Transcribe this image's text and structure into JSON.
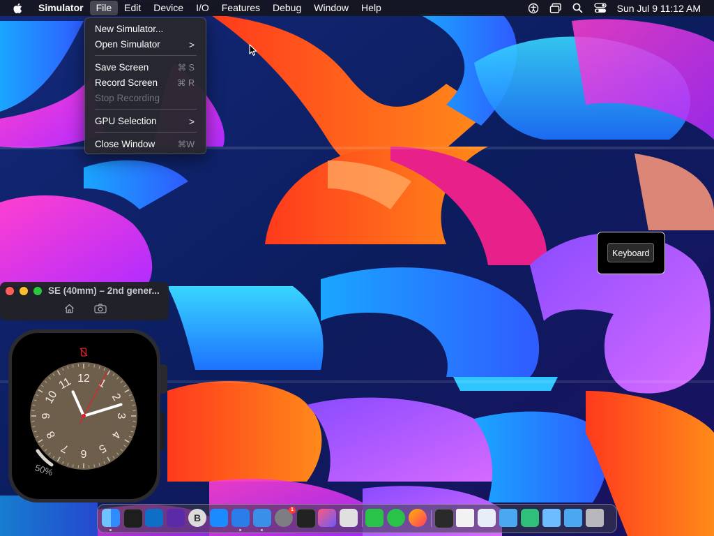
{
  "menubar": {
    "app_name": "Simulator",
    "menus": [
      "File",
      "Edit",
      "Device",
      "I/O",
      "Features",
      "Debug",
      "Window",
      "Help"
    ],
    "open_menu": "File",
    "clock": "Sun Jul 9  11:12 AM",
    "status_icons": [
      "accessibility-icon",
      "screen-mirroring-icon",
      "search-icon",
      "control-center-icon"
    ]
  },
  "file_menu": {
    "items": [
      {
        "label": "New Simulator...",
        "shortcut": "",
        "submenu": false,
        "enabled": true
      },
      {
        "label": "Open Simulator",
        "shortcut": "",
        "submenu": true,
        "enabled": true
      },
      {
        "label": "Save Screen",
        "shortcut": "⌘ S",
        "submenu": false,
        "enabled": true
      },
      {
        "label": "Record Screen",
        "shortcut": "⌘ R",
        "submenu": false,
        "enabled": true
      },
      {
        "label": "Stop Recording",
        "shortcut": "",
        "submenu": false,
        "enabled": false
      },
      {
        "label": "GPU Selection",
        "shortcut": "",
        "submenu": true,
        "enabled": true
      },
      {
        "label": "Close Window",
        "shortcut": "⌘W",
        "submenu": false,
        "enabled": true
      }
    ],
    "chevron": ">"
  },
  "simulator_window": {
    "title": "SE (40mm) – 2nd gener...",
    "toolbar_icons": [
      "home-icon",
      "screenshot-icon"
    ],
    "traffic_lights": {
      "close": "#ff5f57",
      "minimize": "#febc2e",
      "zoom": "#28c840"
    }
  },
  "watch": {
    "battery_percent_label": "50%",
    "battery_level": 0.5,
    "hour_numerals": [
      "12",
      "1",
      "2",
      "3",
      "4",
      "5",
      "6",
      "7",
      "8",
      "9",
      "10",
      "11"
    ],
    "time": "11:12",
    "dial_color": "#6e5f4d",
    "second_hand_color": "#e0202a"
  },
  "keyboard_panel": {
    "button_label": "Keyboard"
  },
  "dock": {
    "apps": [
      {
        "name": "finder-icon",
        "running": true
      },
      {
        "name": "terminal-icon",
        "running": false
      },
      {
        "name": "vscode-icon",
        "running": false
      },
      {
        "name": "visual-studio-icon",
        "running": false
      },
      {
        "name": "bbedit-icon",
        "label": "B",
        "running": false
      },
      {
        "name": "app-store-icon",
        "running": false
      },
      {
        "name": "xcode-icon",
        "running": true
      },
      {
        "name": "simulator-icon",
        "running": true
      },
      {
        "name": "system-settings-icon",
        "badge": "1",
        "running": false
      },
      {
        "name": "activity-monitor-icon",
        "running": false
      },
      {
        "name": "shortcuts-icon",
        "running": false
      },
      {
        "name": "launchpad-icon",
        "running": false
      },
      {
        "name": "facetime-icon",
        "running": false
      },
      {
        "name": "messages-icon",
        "running": false
      },
      {
        "name": "firefox-icon",
        "running": false
      },
      {
        "name": "console-icon",
        "running": false
      },
      {
        "name": "document-icon",
        "running": false
      },
      {
        "name": "chrome-remote-icon",
        "running": false
      },
      {
        "name": "folder-icon",
        "running": false
      },
      {
        "name": "network-folder-icon",
        "running": false
      },
      {
        "name": "downloads-folder-icon",
        "running": false
      },
      {
        "name": "folder-icon",
        "running": false
      },
      {
        "name": "trash-icon",
        "running": false
      }
    ]
  }
}
